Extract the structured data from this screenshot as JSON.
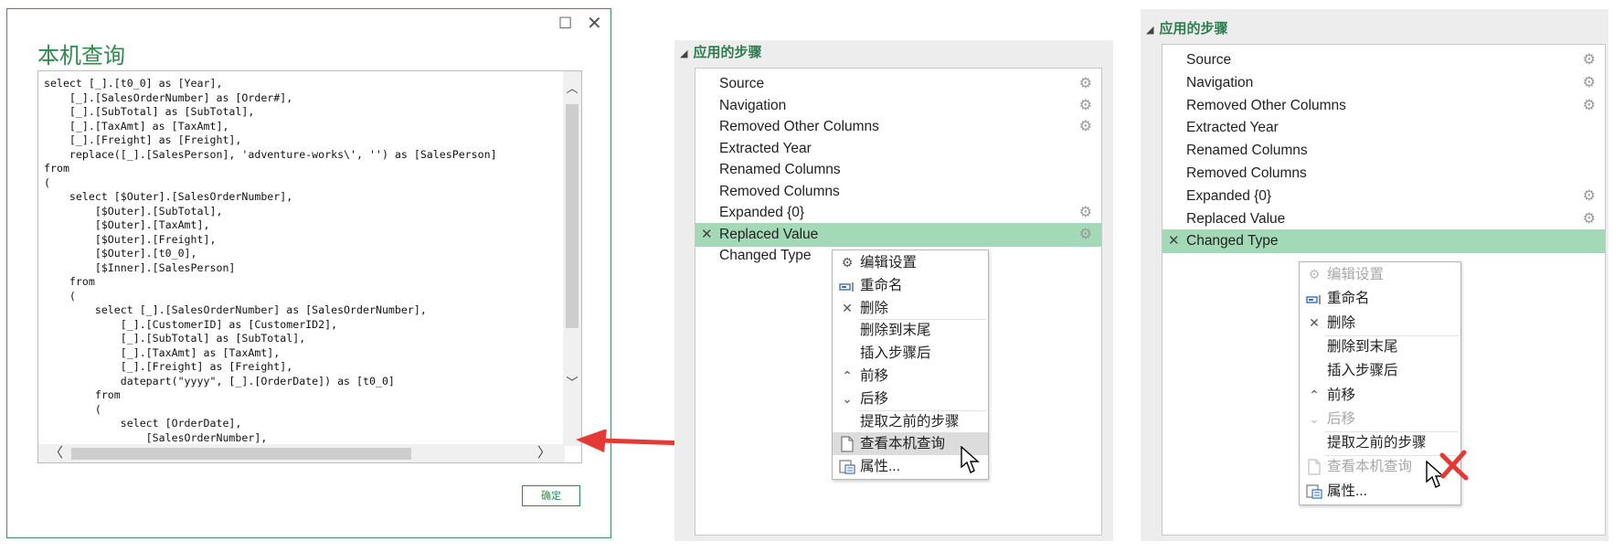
{
  "dialog": {
    "title": "本机查询",
    "maximize_glyph": "☐",
    "close_glyph": "✕",
    "code": "select [_].[t0_0] as [Year],\n    [_].[SalesOrderNumber] as [Order#],\n    [_].[SubTotal] as [SubTotal],\n    [_].[TaxAmt] as [TaxAmt],\n    [_].[Freight] as [Freight],\n    replace([_].[SalesPerson], 'adventure-works\\', '') as [SalesPerson]\nfrom\n(\n    select [$Outer].[SalesOrderNumber],\n        [$Outer].[SubTotal],\n        [$Outer].[TaxAmt],\n        [$Outer].[Freight],\n        [$Outer].[t0_0],\n        [$Inner].[SalesPerson]\n    from\n    (\n        select [_].[SalesOrderNumber] as [SalesOrderNumber],\n            [_].[CustomerID] as [CustomerID2],\n            [_].[SubTotal] as [SubTotal],\n            [_].[TaxAmt] as [TaxAmt],\n            [_].[Freight] as [Freight],\n            datepart(\"yyyy\", [_].[OrderDate]) as [t0_0]\n        from\n        (\n            select [OrderDate],\n                [SalesOrderNumber],",
    "ok_label": "确定"
  },
  "panel_middle": {
    "header": "应用的步骤",
    "steps": [
      {
        "label": "Source",
        "gear": true,
        "selected": false
      },
      {
        "label": "Navigation",
        "gear": true,
        "selected": false
      },
      {
        "label": "Removed Other Columns",
        "gear": true,
        "selected": false
      },
      {
        "label": "Extracted Year",
        "gear": false,
        "selected": false
      },
      {
        "label": "Renamed Columns",
        "gear": false,
        "selected": false
      },
      {
        "label": "Removed Columns",
        "gear": false,
        "selected": false
      },
      {
        "label": "Expanded {0}",
        "gear": true,
        "selected": false
      },
      {
        "label": "Replaced Value",
        "gear": true,
        "selected": true
      },
      {
        "label": "Changed Type",
        "gear": false,
        "selected": false
      }
    ],
    "menu": [
      {
        "label": "编辑设置",
        "icon": "gear-icon",
        "disabled": false
      },
      {
        "label": "重命名",
        "icon": "rename-icon",
        "disabled": false
      },
      {
        "label": "删除",
        "icon": "delete-icon",
        "disabled": false
      },
      {
        "label": "删除到末尾",
        "icon": "",
        "disabled": false
      },
      {
        "label": "插入步骤后",
        "icon": "",
        "disabled": false
      },
      {
        "label": "前移",
        "icon": "chevron-up-icon",
        "disabled": false
      },
      {
        "label": "后移",
        "icon": "chevron-down-icon",
        "disabled": false
      },
      {
        "label": "提取之前的步骤",
        "icon": "",
        "disabled": false
      },
      {
        "label": "查看本机查询",
        "icon": "document-icon",
        "disabled": false
      },
      {
        "label": "属性...",
        "icon": "properties-icon",
        "disabled": false
      }
    ]
  },
  "panel_right": {
    "header": "应用的步骤",
    "steps": [
      {
        "label": "Source",
        "gear": true,
        "selected": false
      },
      {
        "label": "Navigation",
        "gear": true,
        "selected": false
      },
      {
        "label": "Removed Other Columns",
        "gear": true,
        "selected": false
      },
      {
        "label": "Extracted Year",
        "gear": false,
        "selected": false
      },
      {
        "label": "Renamed Columns",
        "gear": false,
        "selected": false
      },
      {
        "label": "Removed Columns",
        "gear": false,
        "selected": false
      },
      {
        "label": "Expanded {0}",
        "gear": true,
        "selected": false
      },
      {
        "label": "Replaced Value",
        "gear": true,
        "selected": false
      },
      {
        "label": "Changed Type",
        "gear": false,
        "selected": true
      }
    ],
    "menu": [
      {
        "label": "编辑设置",
        "icon": "gear-icon",
        "disabled": true
      },
      {
        "label": "重命名",
        "icon": "rename-icon",
        "disabled": false
      },
      {
        "label": "删除",
        "icon": "delete-icon",
        "disabled": false
      },
      {
        "label": "删除到末尾",
        "icon": "",
        "disabled": false
      },
      {
        "label": "插入步骤后",
        "icon": "",
        "disabled": false
      },
      {
        "label": "前移",
        "icon": "chevron-up-icon",
        "disabled": false
      },
      {
        "label": "后移",
        "icon": "chevron-down-icon",
        "disabled": true
      },
      {
        "label": "提取之前的步骤",
        "icon": "",
        "disabled": false
      },
      {
        "label": "查看本机查询",
        "icon": "document-icon",
        "disabled": true
      },
      {
        "label": "属性...",
        "icon": "properties-icon",
        "disabled": false
      }
    ]
  },
  "colors": {
    "accent_green": "#2e8b4e",
    "selected_row": "#a4d9b7",
    "arrow_red": "#e53935",
    "disabled_x": "#e53935"
  },
  "icons": {
    "gear": "⚙",
    "delete": "✕",
    "chevron_up": "⌃",
    "chevron_down": "⌄",
    "expand_triangle": "◢",
    "scroll_up": "︿",
    "scroll_down": "﹀",
    "scroll_left": "〈",
    "scroll_right": "〉"
  }
}
